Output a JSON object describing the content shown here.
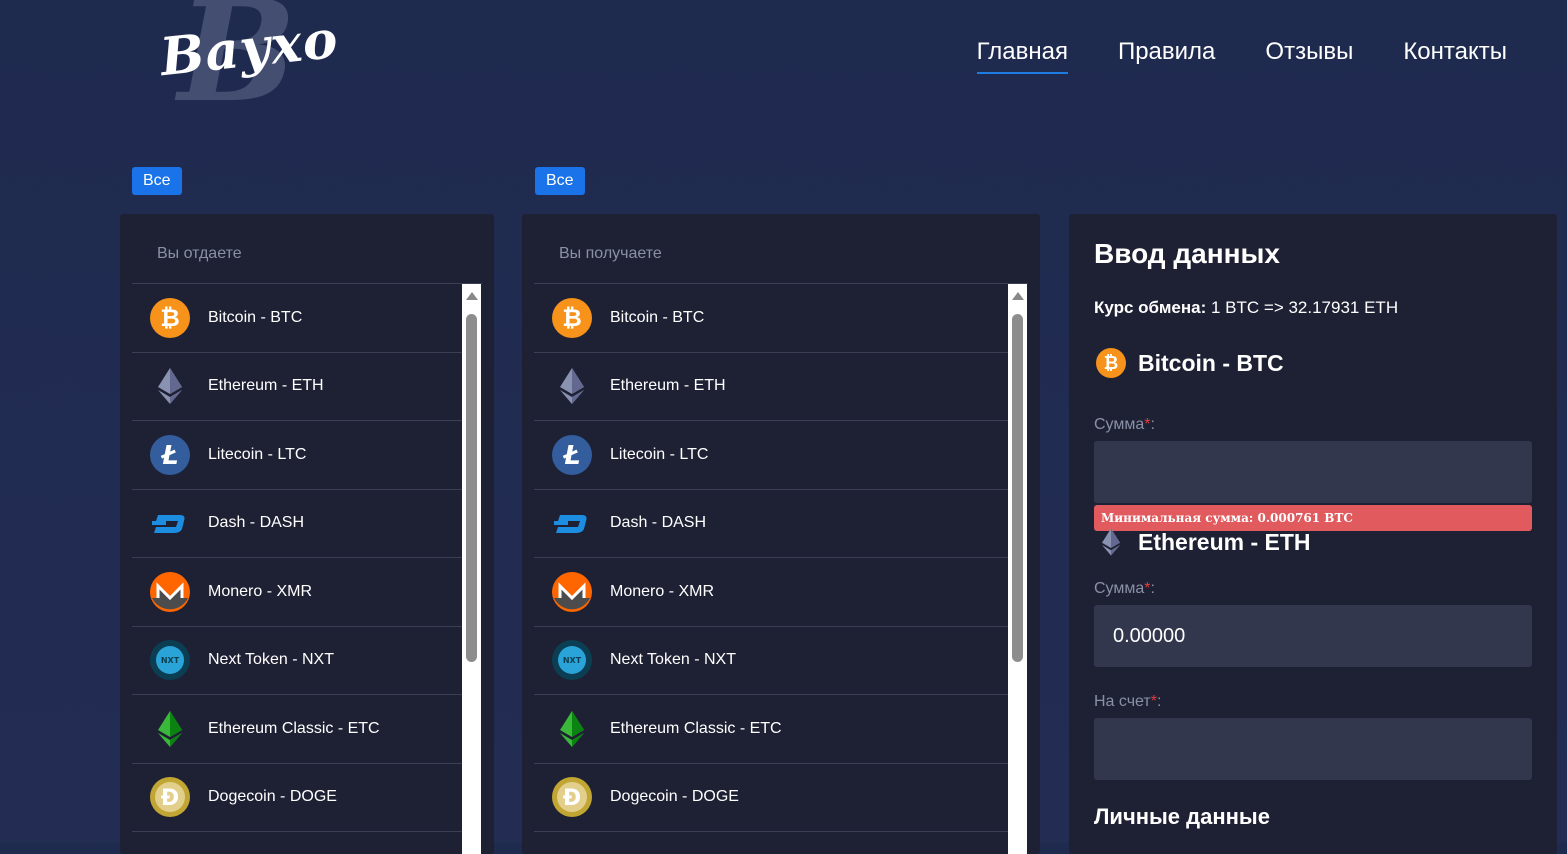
{
  "header": {
    "logo_text": "Bayxo",
    "logo_letter": "B",
    "nav": [
      {
        "label": "Главная",
        "active": true
      },
      {
        "label": "Правила",
        "active": false
      },
      {
        "label": "Отзывы",
        "active": false
      },
      {
        "label": "Контакты",
        "active": false
      }
    ]
  },
  "filters": {
    "left_label": "Все",
    "right_label": "Все"
  },
  "give_panel": {
    "title": "Вы отдаете"
  },
  "get_panel": {
    "title": "Вы получаете"
  },
  "coins": [
    {
      "name": "Bitcoin - BTC",
      "icon": "bitcoin-icon"
    },
    {
      "name": "Ethereum - ETH",
      "icon": "ethereum-icon"
    },
    {
      "name": "Litecoin - LTC",
      "icon": "litecoin-icon"
    },
    {
      "name": "Dash - DASH",
      "icon": "dash-icon"
    },
    {
      "name": "Monero - XMR",
      "icon": "monero-icon"
    },
    {
      "name": "Next Token - NXT",
      "icon": "nxt-icon"
    },
    {
      "name": "Ethereum Classic - ETC",
      "icon": "ethereum-classic-icon"
    },
    {
      "name": "Dogecoin - DOGE",
      "icon": "dogecoin-icon"
    }
  ],
  "form": {
    "title": "Ввод данных",
    "rate_label": "Курс обмена:",
    "rate_value": "1 BTC => 32.17931 ETH",
    "give_coin": "Bitcoin - BTC",
    "give_amount_label": "Сумма",
    "give_amount_value": "",
    "min_amount_error": "Минимальная сумма: 0.000761 BTC",
    "get_coin": "Ethereum - ETH",
    "get_amount_label": "Сумма",
    "get_amount_value": "0.00000",
    "account_label": "На счет",
    "account_value": "",
    "required_mark": "*",
    "label_suffix": ":",
    "personal_section": "Личные данные"
  },
  "colors": {
    "background": "#232d54",
    "panel": "#1e2133",
    "accent": "#1a73e8",
    "error": "#e05a5e",
    "input": "#33374d"
  }
}
